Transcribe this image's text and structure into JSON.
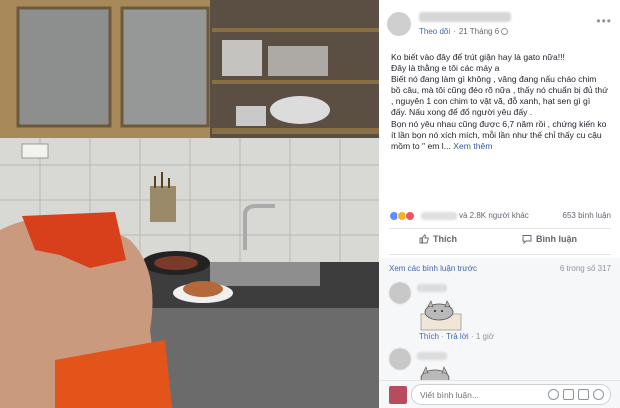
{
  "post": {
    "follow_label": "Theo dõi",
    "separator": "·",
    "date": "21 Tháng 6",
    "more_label": "•••",
    "lines": [
      "Ko biết vào đây để trút giận hay là gato nữa!!!",
      "Đây là thằng e tôi các máy a",
      "Biết nó đang làm gì không , vâng đang nấu cháo chim bồ câu, mà tôi cũng đéo rõ nữa , thấy nó chuẩn bị đủ thứ , nguyên 1 con chim to vật vã, đỗ xanh, hạt sen gì gì đấy. Nấu xong để đổ người yêu đấy .",
      "Bọn nó yêu nhau cũng được 6,7 năm rồi , chứng kiến ko ít lần bọn nó xích mích, mỗi lần như thế chỉ thấy cu cậu mồm to \" em l..."
    ],
    "see_more": "Xem thêm"
  },
  "reactions": {
    "count_text": "và 2.8K người khác",
    "comments_text": "653 bình luận"
  },
  "actions": {
    "like_label": "Thích",
    "comment_label": "Bình luận"
  },
  "comments": {
    "previous_label": "Xem các bình luận trước",
    "position_text": "6 trong số 317",
    "first": {
      "like_label": "Thích",
      "reply_label": "Trả lời",
      "time": "1 giờ"
    }
  },
  "composer": {
    "placeholder": "Viết bình luận..."
  },
  "colors": {
    "link": "#4267b2",
    "like": "#5890ff",
    "haha": "#f7b125",
    "love": "#f25268"
  }
}
